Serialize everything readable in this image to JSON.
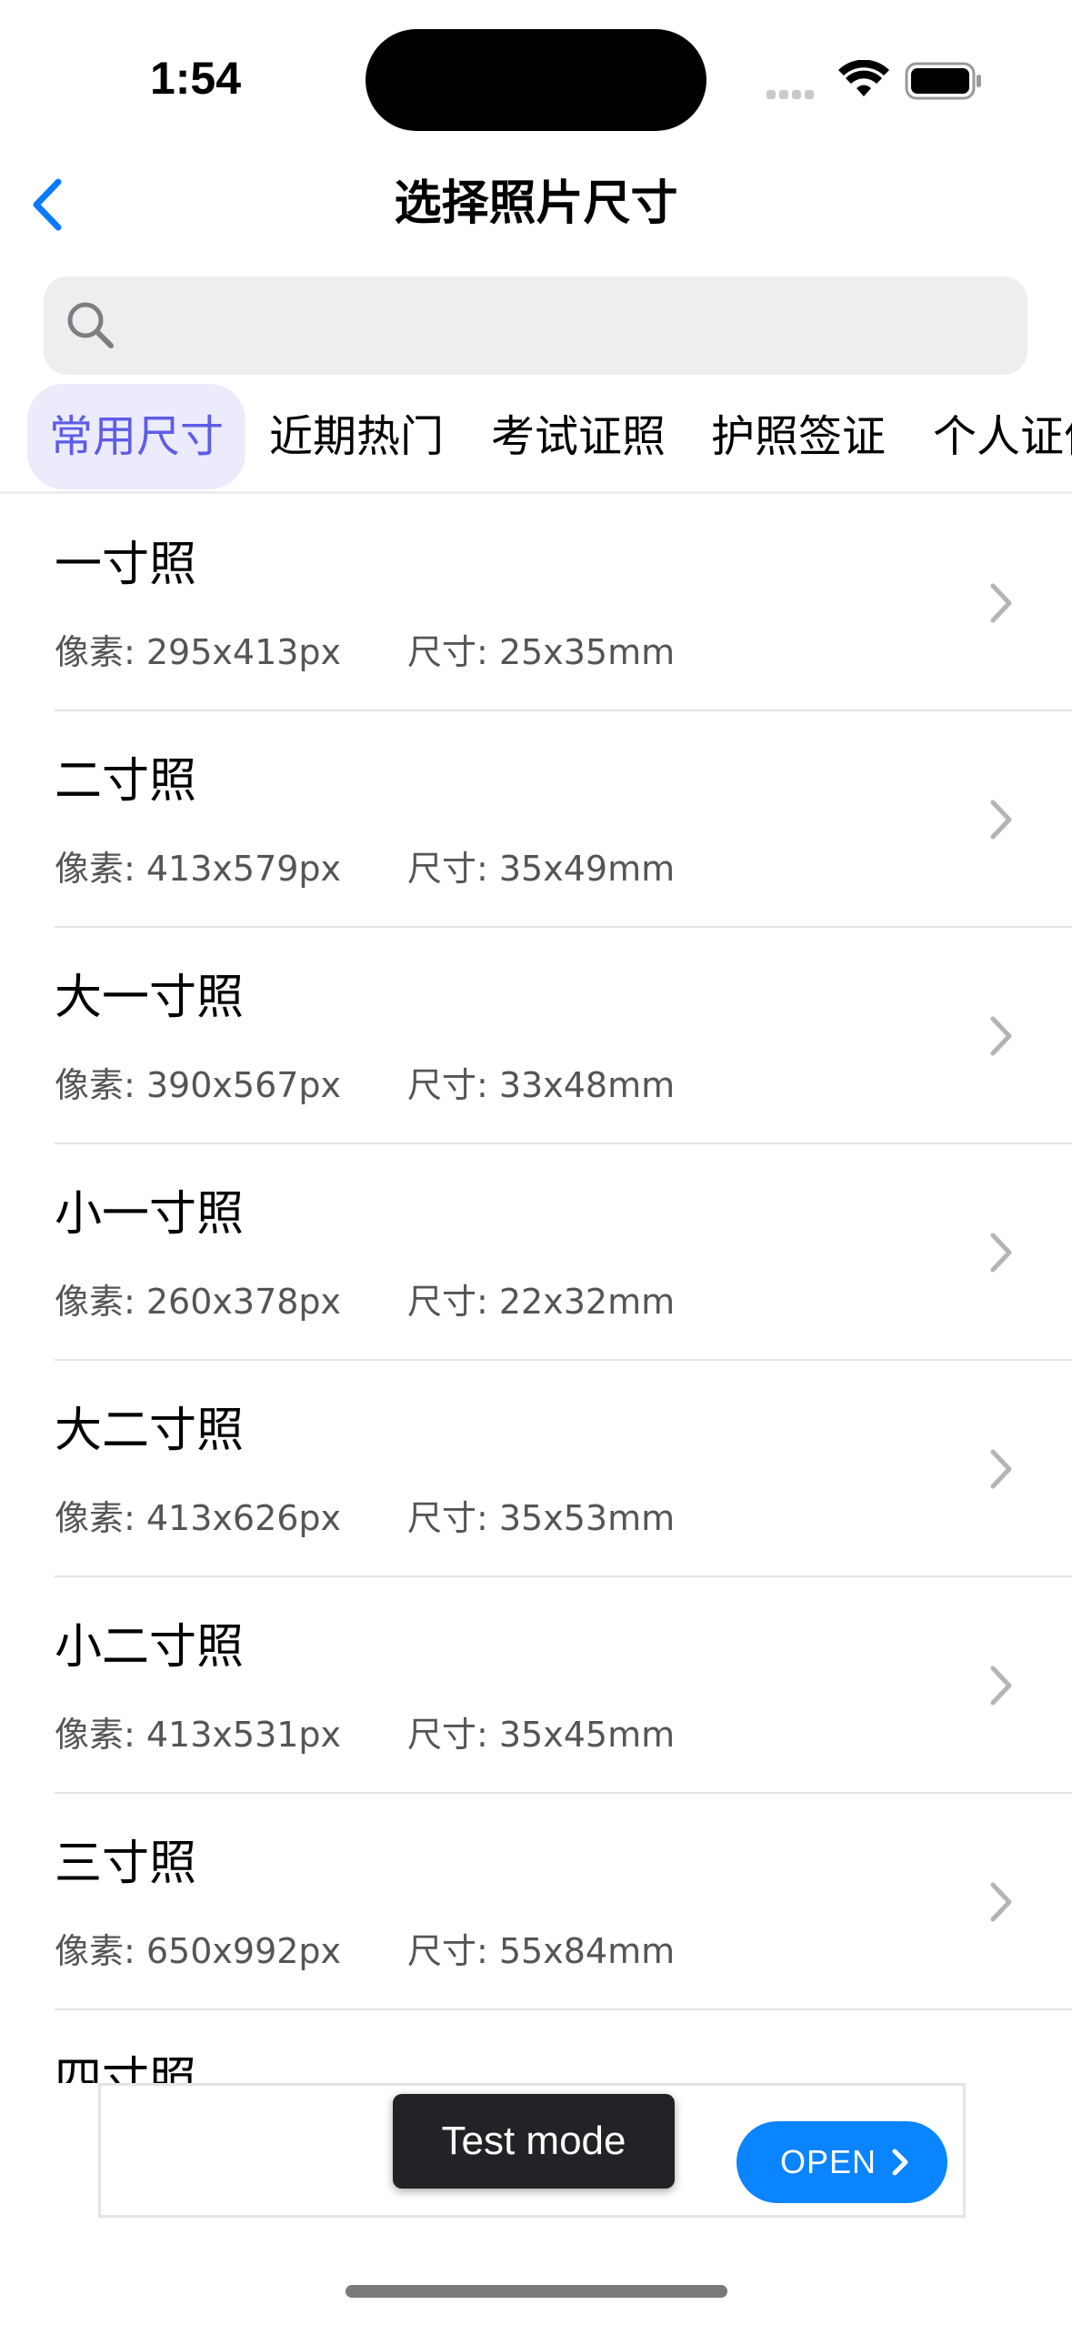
{
  "status_bar": {
    "time": "1:54"
  },
  "header": {
    "title": "选择照片尺寸"
  },
  "search": {
    "placeholder": ""
  },
  "tabs": [
    {
      "label": "常用尺寸",
      "active": true
    },
    {
      "label": "近期热门",
      "active": false
    },
    {
      "label": "考试证照",
      "active": false
    },
    {
      "label": "护照签证",
      "active": false
    },
    {
      "label": "个人证件",
      "active": false
    }
  ],
  "items": [
    {
      "title": "一寸照",
      "pixel": "像素: 295x413px",
      "size": "尺寸: 25x35mm"
    },
    {
      "title": "二寸照",
      "pixel": "像素: 413x579px",
      "size": "尺寸: 35x49mm"
    },
    {
      "title": "大一寸照",
      "pixel": "像素: 390x567px",
      "size": "尺寸: 33x48mm"
    },
    {
      "title": "小一寸照",
      "pixel": "像素: 260x378px",
      "size": "尺寸: 22x32mm"
    },
    {
      "title": "大二寸照",
      "pixel": "像素: 413x626px",
      "size": "尺寸: 35x53mm"
    },
    {
      "title": "小二寸照",
      "pixel": "像素: 413x531px",
      "size": "尺寸: 35x45mm"
    },
    {
      "title": "三寸照",
      "pixel": "像素: 650x992px",
      "size": "尺寸: 55x84mm"
    },
    {
      "title": "四寸照",
      "pixel": "",
      "size": ""
    }
  ],
  "ad": {
    "test_mode_label": "Test mode",
    "open_label": "OPEN"
  },
  "colors": {
    "accent": "#5e5ce6",
    "back_blue": "#0a7aff",
    "open_blue": "#0a84ff",
    "tab_active_bg": "#ebebfb"
  }
}
